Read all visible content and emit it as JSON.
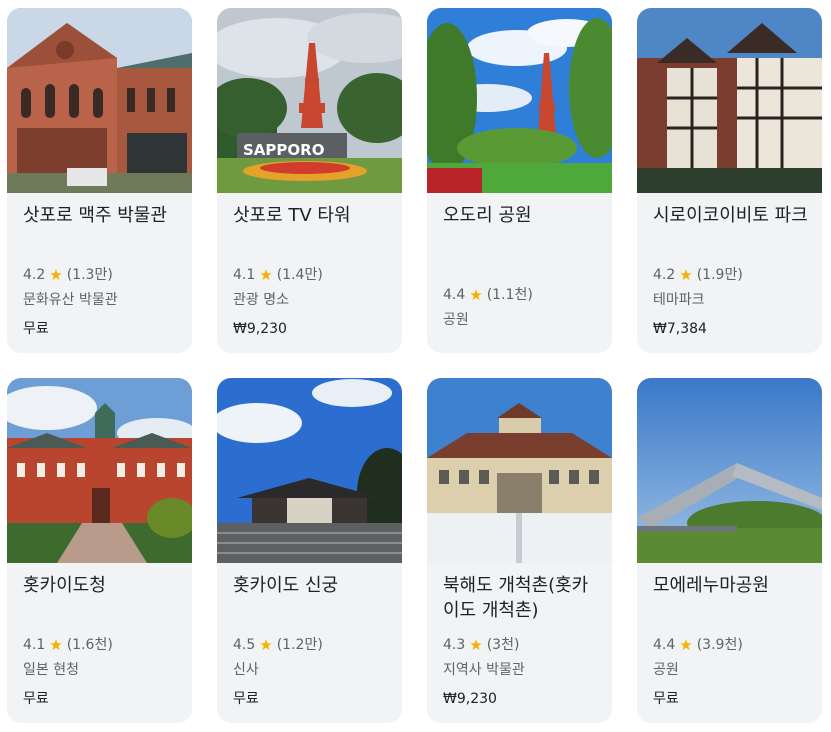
{
  "places": [
    {
      "title": "삿포로 맥주 박물관",
      "rating": "4.2",
      "reviews": "(1.3만)",
      "category": "문화유산 박물관",
      "price": "무료",
      "image": "brick-museum-image"
    },
    {
      "title": "삿포로 TV 타워",
      "rating": "4.1",
      "reviews": "(1.4만)",
      "category": "관광 명소",
      "price": "₩9,230",
      "image": "tv-tower-image",
      "sign": "SAPPORO"
    },
    {
      "title": "오도리 공원",
      "rating": "4.4",
      "reviews": "(1.1천)",
      "category": "공원",
      "price": "",
      "image": "park-tower-image"
    },
    {
      "title": "시로이코이비토 파크",
      "rating": "4.2",
      "reviews": "(1.9만)",
      "category": "테마파크",
      "price": "₩7,384",
      "image": "tudor-building-image"
    },
    {
      "title": "홋카이도청",
      "rating": "4.1",
      "reviews": "(1.6천)",
      "category": "일본 현청",
      "price": "무료",
      "image": "red-brick-government-image"
    },
    {
      "title": "홋카이도 신궁",
      "rating": "4.5",
      "reviews": "(1.2만)",
      "category": "신사",
      "price": "무료",
      "image": "shrine-image"
    },
    {
      "title": "북해도 개척촌(홋카이도 개척촌)",
      "rating": "4.3",
      "reviews": "(3천)",
      "category": "지역사 박물관",
      "price": "₩9,230",
      "image": "snowy-station-image"
    },
    {
      "title": "모에레누마공원",
      "rating": "4.4",
      "reviews": "(3.9천)",
      "category": "공원",
      "price": "무료",
      "image": "moerenuma-sculpture-image"
    }
  ],
  "colors": {
    "star": "#f6b000",
    "card_bg": "#f1f3f4"
  }
}
